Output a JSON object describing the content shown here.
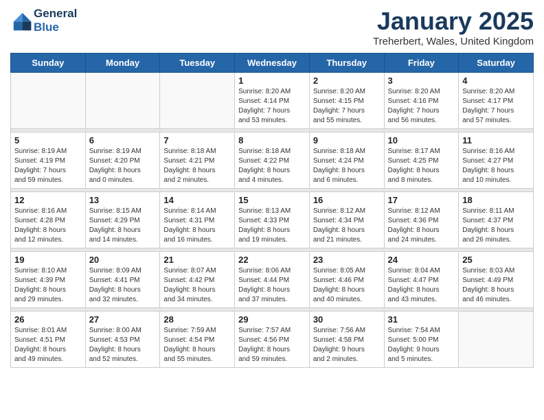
{
  "header": {
    "logo_line1": "General",
    "logo_line2": "Blue",
    "title": "January 2025",
    "subtitle": "Treherbert, Wales, United Kingdom"
  },
  "days_of_week": [
    "Sunday",
    "Monday",
    "Tuesday",
    "Wednesday",
    "Thursday",
    "Friday",
    "Saturday"
  ],
  "weeks": [
    {
      "days": [
        {
          "num": "",
          "info": ""
        },
        {
          "num": "",
          "info": ""
        },
        {
          "num": "",
          "info": ""
        },
        {
          "num": "1",
          "info": "Sunrise: 8:20 AM\nSunset: 4:14 PM\nDaylight: 7 hours\nand 53 minutes."
        },
        {
          "num": "2",
          "info": "Sunrise: 8:20 AM\nSunset: 4:15 PM\nDaylight: 7 hours\nand 55 minutes."
        },
        {
          "num": "3",
          "info": "Sunrise: 8:20 AM\nSunset: 4:16 PM\nDaylight: 7 hours\nand 56 minutes."
        },
        {
          "num": "4",
          "info": "Sunrise: 8:20 AM\nSunset: 4:17 PM\nDaylight: 7 hours\nand 57 minutes."
        }
      ]
    },
    {
      "days": [
        {
          "num": "5",
          "info": "Sunrise: 8:19 AM\nSunset: 4:19 PM\nDaylight: 7 hours\nand 59 minutes."
        },
        {
          "num": "6",
          "info": "Sunrise: 8:19 AM\nSunset: 4:20 PM\nDaylight: 8 hours\nand 0 minutes."
        },
        {
          "num": "7",
          "info": "Sunrise: 8:18 AM\nSunset: 4:21 PM\nDaylight: 8 hours\nand 2 minutes."
        },
        {
          "num": "8",
          "info": "Sunrise: 8:18 AM\nSunset: 4:22 PM\nDaylight: 8 hours\nand 4 minutes."
        },
        {
          "num": "9",
          "info": "Sunrise: 8:18 AM\nSunset: 4:24 PM\nDaylight: 8 hours\nand 6 minutes."
        },
        {
          "num": "10",
          "info": "Sunrise: 8:17 AM\nSunset: 4:25 PM\nDaylight: 8 hours\nand 8 minutes."
        },
        {
          "num": "11",
          "info": "Sunrise: 8:16 AM\nSunset: 4:27 PM\nDaylight: 8 hours\nand 10 minutes."
        }
      ]
    },
    {
      "days": [
        {
          "num": "12",
          "info": "Sunrise: 8:16 AM\nSunset: 4:28 PM\nDaylight: 8 hours\nand 12 minutes."
        },
        {
          "num": "13",
          "info": "Sunrise: 8:15 AM\nSunset: 4:29 PM\nDaylight: 8 hours\nand 14 minutes."
        },
        {
          "num": "14",
          "info": "Sunrise: 8:14 AM\nSunset: 4:31 PM\nDaylight: 8 hours\nand 16 minutes."
        },
        {
          "num": "15",
          "info": "Sunrise: 8:13 AM\nSunset: 4:33 PM\nDaylight: 8 hours\nand 19 minutes."
        },
        {
          "num": "16",
          "info": "Sunrise: 8:12 AM\nSunset: 4:34 PM\nDaylight: 8 hours\nand 21 minutes."
        },
        {
          "num": "17",
          "info": "Sunrise: 8:12 AM\nSunset: 4:36 PM\nDaylight: 8 hours\nand 24 minutes."
        },
        {
          "num": "18",
          "info": "Sunrise: 8:11 AM\nSunset: 4:37 PM\nDaylight: 8 hours\nand 26 minutes."
        }
      ]
    },
    {
      "days": [
        {
          "num": "19",
          "info": "Sunrise: 8:10 AM\nSunset: 4:39 PM\nDaylight: 8 hours\nand 29 minutes."
        },
        {
          "num": "20",
          "info": "Sunrise: 8:09 AM\nSunset: 4:41 PM\nDaylight: 8 hours\nand 32 minutes."
        },
        {
          "num": "21",
          "info": "Sunrise: 8:07 AM\nSunset: 4:42 PM\nDaylight: 8 hours\nand 34 minutes."
        },
        {
          "num": "22",
          "info": "Sunrise: 8:06 AM\nSunset: 4:44 PM\nDaylight: 8 hours\nand 37 minutes."
        },
        {
          "num": "23",
          "info": "Sunrise: 8:05 AM\nSunset: 4:46 PM\nDaylight: 8 hours\nand 40 minutes."
        },
        {
          "num": "24",
          "info": "Sunrise: 8:04 AM\nSunset: 4:47 PM\nDaylight: 8 hours\nand 43 minutes."
        },
        {
          "num": "25",
          "info": "Sunrise: 8:03 AM\nSunset: 4:49 PM\nDaylight: 8 hours\nand 46 minutes."
        }
      ]
    },
    {
      "days": [
        {
          "num": "26",
          "info": "Sunrise: 8:01 AM\nSunset: 4:51 PM\nDaylight: 8 hours\nand 49 minutes."
        },
        {
          "num": "27",
          "info": "Sunrise: 8:00 AM\nSunset: 4:53 PM\nDaylight: 8 hours\nand 52 minutes."
        },
        {
          "num": "28",
          "info": "Sunrise: 7:59 AM\nSunset: 4:54 PM\nDaylight: 8 hours\nand 55 minutes."
        },
        {
          "num": "29",
          "info": "Sunrise: 7:57 AM\nSunset: 4:56 PM\nDaylight: 8 hours\nand 59 minutes."
        },
        {
          "num": "30",
          "info": "Sunrise: 7:56 AM\nSunset: 4:58 PM\nDaylight: 9 hours\nand 2 minutes."
        },
        {
          "num": "31",
          "info": "Sunrise: 7:54 AM\nSunset: 5:00 PM\nDaylight: 9 hours\nand 5 minutes."
        },
        {
          "num": "",
          "info": ""
        }
      ]
    }
  ]
}
